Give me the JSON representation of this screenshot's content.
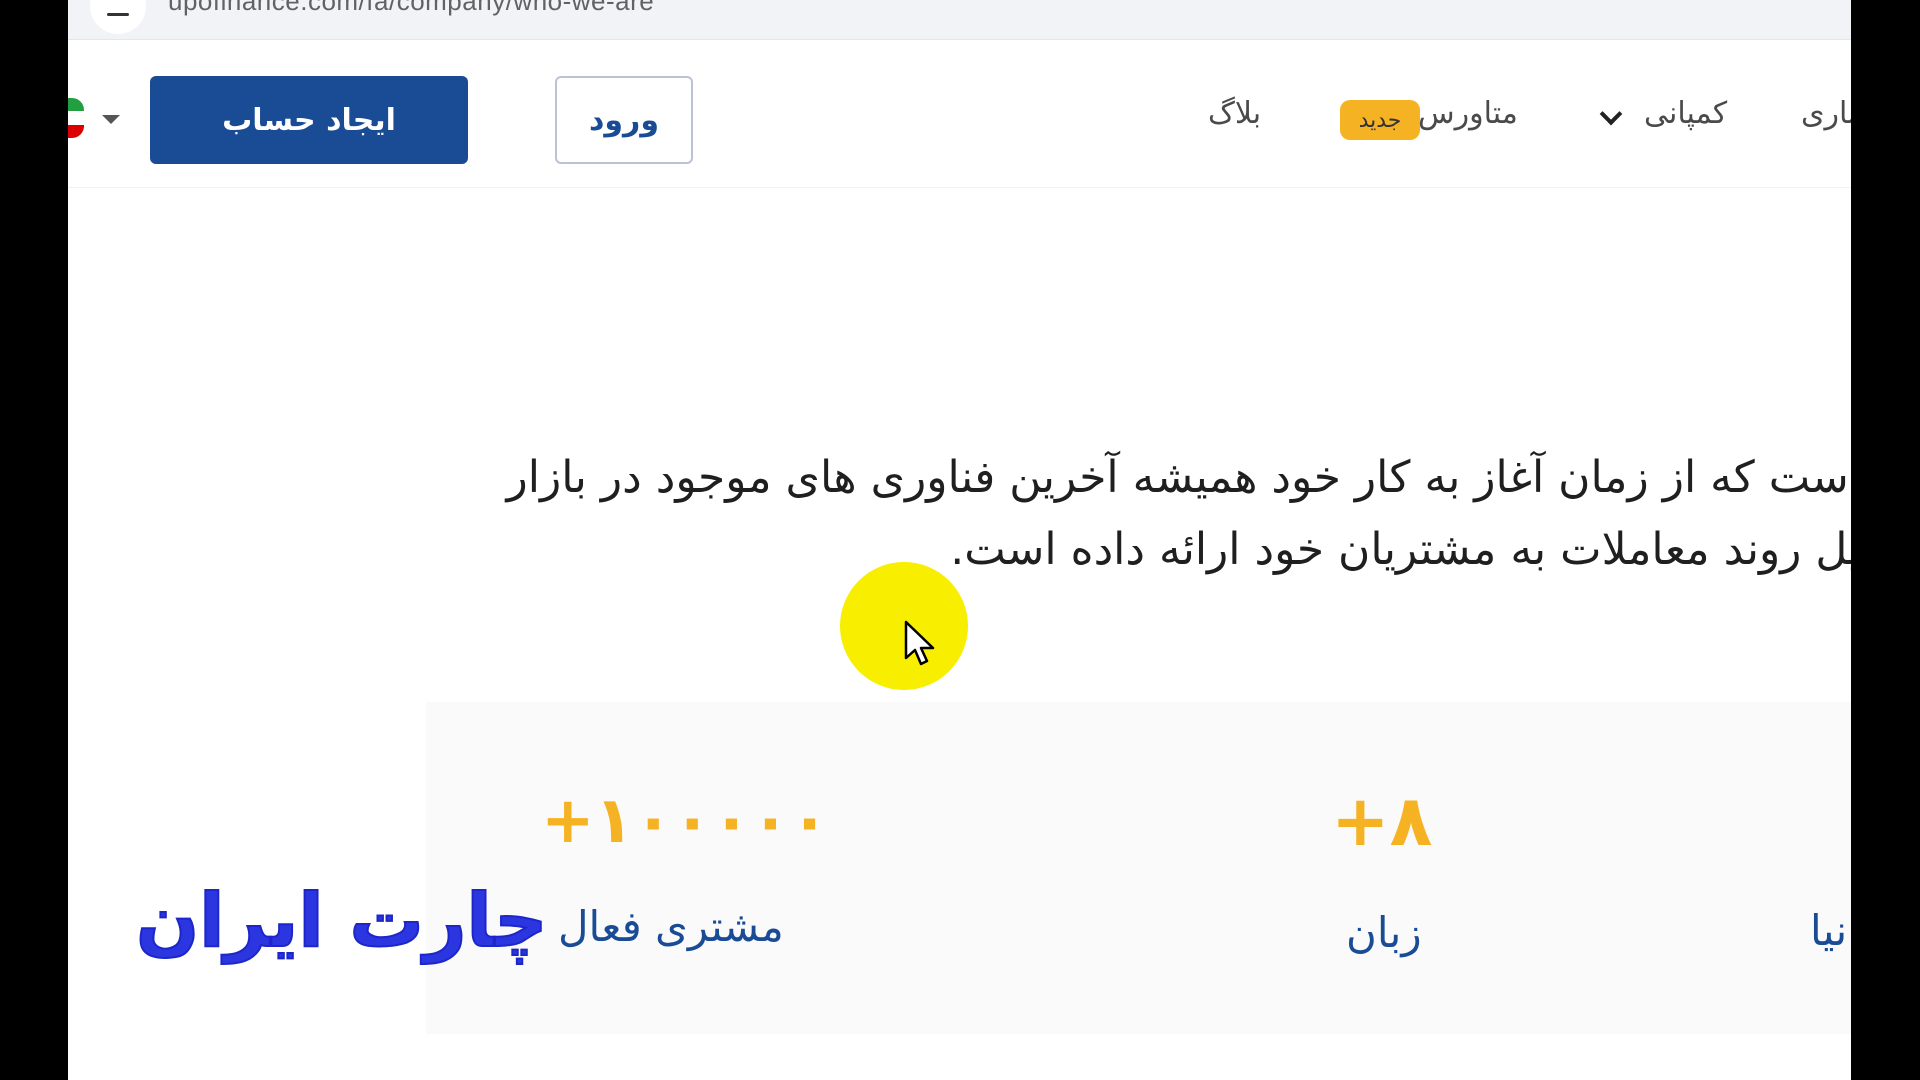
{
  "browser": {
    "url": "upofinance.com/fa/company/who-we-are"
  },
  "header": {
    "signup_label": "ایجاد حساب",
    "login_label": "ورود",
    "nav": {
      "blog": "بلاگ",
      "metaverse": "متاورس",
      "new_badge": "جدید",
      "company": "کمپانی",
      "partial_item": "ناری"
    },
    "flag_colors": [
      "#239f40",
      "#ffffff",
      "#da0000"
    ]
  },
  "description": {
    "line1": "است که از زمان آغاز به کار خود همیشه آخرین فناوری های موجود در بازار",
    "line2": "یل روند معاملات به مشتریان خود ارائه داده است."
  },
  "stats": {
    "customers": {
      "value": "+۱۰۰۰۰۰",
      "label": "مشتری فعال"
    },
    "languages": {
      "value": "+۸",
      "label": "زبان"
    },
    "partial_label": "نیا"
  },
  "watermark": {
    "text": "چارت ایران"
  },
  "colors": {
    "primary": "#1a4c96",
    "accent": "#f5b324",
    "watermark": "#2b35e0",
    "cursor_highlight": "#f7ee00"
  }
}
